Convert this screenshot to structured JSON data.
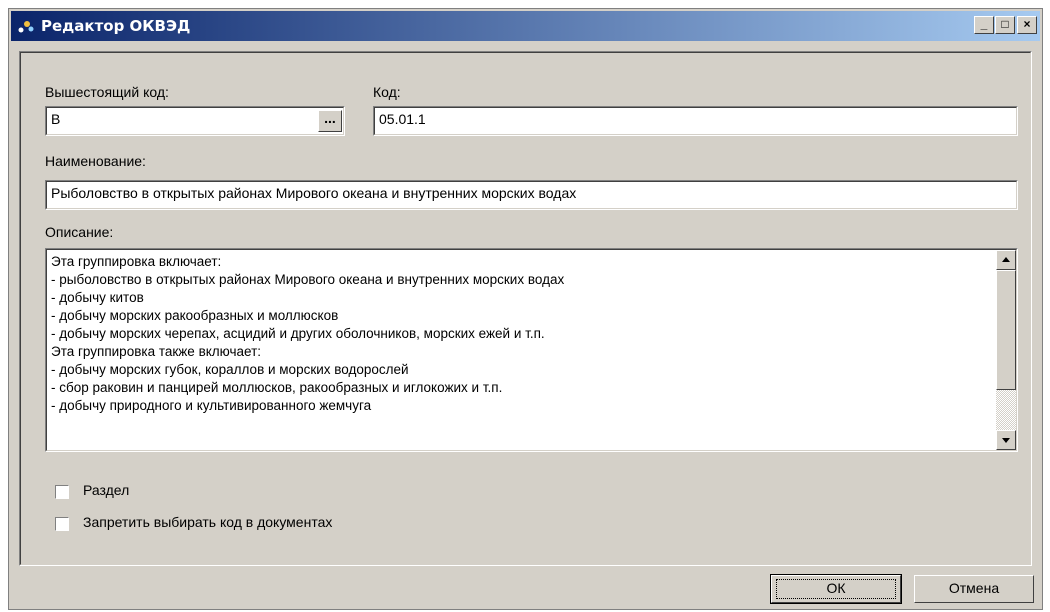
{
  "window": {
    "title": "Редактор ОКВЭД"
  },
  "form": {
    "parent_code": {
      "label": "Вышестоящий код:",
      "value": "В",
      "button_label": "..."
    },
    "code": {
      "label": "Код:",
      "value": "05.01.1"
    },
    "name": {
      "label": "Наименование:",
      "value": "Рыболовство в открытых районах Мирового океана и внутренних морских водах"
    },
    "description": {
      "label": "Описание:",
      "lines": [
        "Эта группировка включает:",
        "- рыболовство в открытых районах Мирового океана и внутренних морских водах",
        "- добычу китов",
        "- добычу морских ракообразных и моллюсков",
        "- добычу морских черепах, асцидий и других оболочников, морских ежей и т.п.",
        "Эта группировка также включает:",
        "- добычу морских губок, кораллов и морских водорослей",
        "- сбор раковин и панцирей моллюсков, ракообразных и иглокожих и т.п.",
        "- добычу природного и культивированного жемчуга"
      ]
    },
    "checkboxes": [
      {
        "label": "Раздел",
        "checked": false
      },
      {
        "label": "Запретить выбирать код в документах",
        "checked": false
      }
    ]
  },
  "buttons": {
    "ok": "ОК",
    "cancel": "Отмена"
  }
}
